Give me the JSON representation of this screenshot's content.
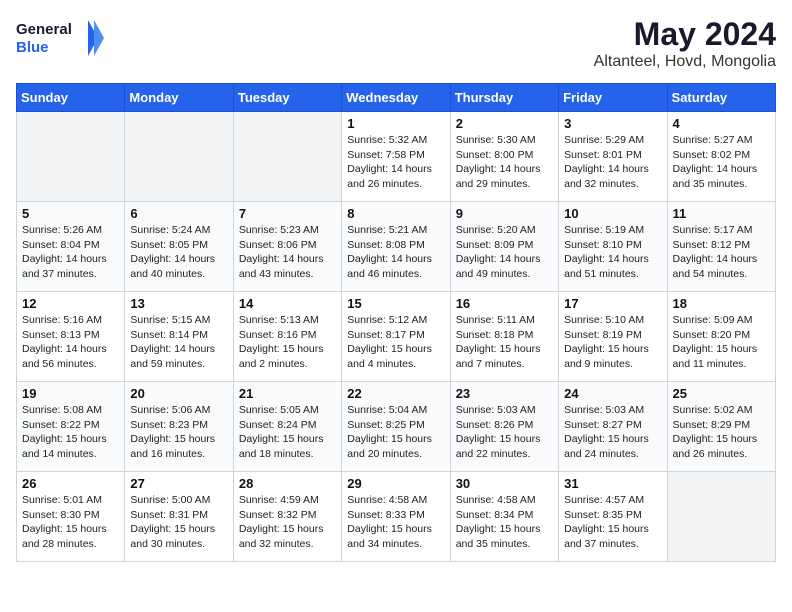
{
  "logo": {
    "line1": "General",
    "line2": "Blue"
  },
  "title": "May 2024",
  "subtitle": "Altanteel, Hovd, Mongolia",
  "days_of_week": [
    "Sunday",
    "Monday",
    "Tuesday",
    "Wednesday",
    "Thursday",
    "Friday",
    "Saturday"
  ],
  "weeks": [
    [
      {
        "num": "",
        "info": ""
      },
      {
        "num": "",
        "info": ""
      },
      {
        "num": "",
        "info": ""
      },
      {
        "num": "1",
        "info": "Sunrise: 5:32 AM\nSunset: 7:58 PM\nDaylight: 14 hours and 26 minutes."
      },
      {
        "num": "2",
        "info": "Sunrise: 5:30 AM\nSunset: 8:00 PM\nDaylight: 14 hours and 29 minutes."
      },
      {
        "num": "3",
        "info": "Sunrise: 5:29 AM\nSunset: 8:01 PM\nDaylight: 14 hours and 32 minutes."
      },
      {
        "num": "4",
        "info": "Sunrise: 5:27 AM\nSunset: 8:02 PM\nDaylight: 14 hours and 35 minutes."
      }
    ],
    [
      {
        "num": "5",
        "info": "Sunrise: 5:26 AM\nSunset: 8:04 PM\nDaylight: 14 hours and 37 minutes."
      },
      {
        "num": "6",
        "info": "Sunrise: 5:24 AM\nSunset: 8:05 PM\nDaylight: 14 hours and 40 minutes."
      },
      {
        "num": "7",
        "info": "Sunrise: 5:23 AM\nSunset: 8:06 PM\nDaylight: 14 hours and 43 minutes."
      },
      {
        "num": "8",
        "info": "Sunrise: 5:21 AM\nSunset: 8:08 PM\nDaylight: 14 hours and 46 minutes."
      },
      {
        "num": "9",
        "info": "Sunrise: 5:20 AM\nSunset: 8:09 PM\nDaylight: 14 hours and 49 minutes."
      },
      {
        "num": "10",
        "info": "Sunrise: 5:19 AM\nSunset: 8:10 PM\nDaylight: 14 hours and 51 minutes."
      },
      {
        "num": "11",
        "info": "Sunrise: 5:17 AM\nSunset: 8:12 PM\nDaylight: 14 hours and 54 minutes."
      }
    ],
    [
      {
        "num": "12",
        "info": "Sunrise: 5:16 AM\nSunset: 8:13 PM\nDaylight: 14 hours and 56 minutes."
      },
      {
        "num": "13",
        "info": "Sunrise: 5:15 AM\nSunset: 8:14 PM\nDaylight: 14 hours and 59 minutes."
      },
      {
        "num": "14",
        "info": "Sunrise: 5:13 AM\nSunset: 8:16 PM\nDaylight: 15 hours and 2 minutes."
      },
      {
        "num": "15",
        "info": "Sunrise: 5:12 AM\nSunset: 8:17 PM\nDaylight: 15 hours and 4 minutes."
      },
      {
        "num": "16",
        "info": "Sunrise: 5:11 AM\nSunset: 8:18 PM\nDaylight: 15 hours and 7 minutes."
      },
      {
        "num": "17",
        "info": "Sunrise: 5:10 AM\nSunset: 8:19 PM\nDaylight: 15 hours and 9 minutes."
      },
      {
        "num": "18",
        "info": "Sunrise: 5:09 AM\nSunset: 8:20 PM\nDaylight: 15 hours and 11 minutes."
      }
    ],
    [
      {
        "num": "19",
        "info": "Sunrise: 5:08 AM\nSunset: 8:22 PM\nDaylight: 15 hours and 14 minutes."
      },
      {
        "num": "20",
        "info": "Sunrise: 5:06 AM\nSunset: 8:23 PM\nDaylight: 15 hours and 16 minutes."
      },
      {
        "num": "21",
        "info": "Sunrise: 5:05 AM\nSunset: 8:24 PM\nDaylight: 15 hours and 18 minutes."
      },
      {
        "num": "22",
        "info": "Sunrise: 5:04 AM\nSunset: 8:25 PM\nDaylight: 15 hours and 20 minutes."
      },
      {
        "num": "23",
        "info": "Sunrise: 5:03 AM\nSunset: 8:26 PM\nDaylight: 15 hours and 22 minutes."
      },
      {
        "num": "24",
        "info": "Sunrise: 5:03 AM\nSunset: 8:27 PM\nDaylight: 15 hours and 24 minutes."
      },
      {
        "num": "25",
        "info": "Sunrise: 5:02 AM\nSunset: 8:29 PM\nDaylight: 15 hours and 26 minutes."
      }
    ],
    [
      {
        "num": "26",
        "info": "Sunrise: 5:01 AM\nSunset: 8:30 PM\nDaylight: 15 hours and 28 minutes."
      },
      {
        "num": "27",
        "info": "Sunrise: 5:00 AM\nSunset: 8:31 PM\nDaylight: 15 hours and 30 minutes."
      },
      {
        "num": "28",
        "info": "Sunrise: 4:59 AM\nSunset: 8:32 PM\nDaylight: 15 hours and 32 minutes."
      },
      {
        "num": "29",
        "info": "Sunrise: 4:58 AM\nSunset: 8:33 PM\nDaylight: 15 hours and 34 minutes."
      },
      {
        "num": "30",
        "info": "Sunrise: 4:58 AM\nSunset: 8:34 PM\nDaylight: 15 hours and 35 minutes."
      },
      {
        "num": "31",
        "info": "Sunrise: 4:57 AM\nSunset: 8:35 PM\nDaylight: 15 hours and 37 minutes."
      },
      {
        "num": "",
        "info": ""
      }
    ]
  ]
}
